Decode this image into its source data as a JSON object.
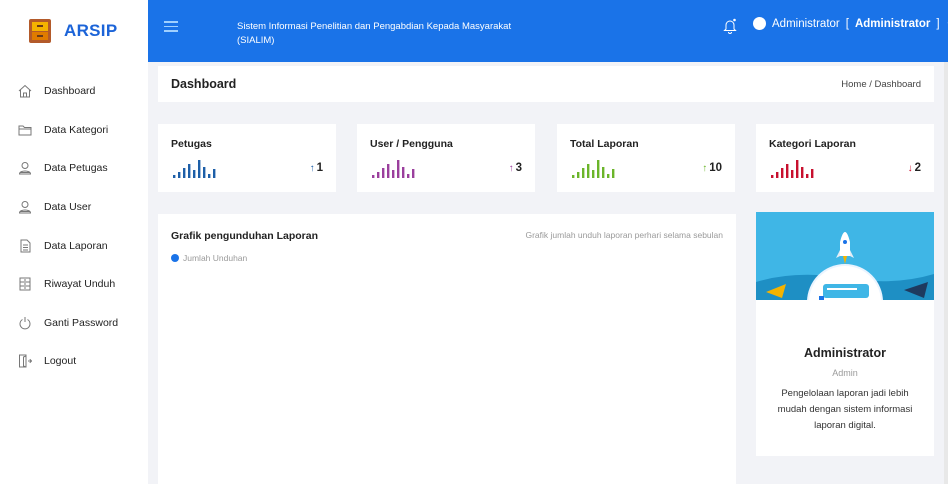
{
  "brand": {
    "name": "ARSIP"
  },
  "topbar": {
    "title": "Sistem Informasi Penelitian dan Pengabdian Kepada Masyarakat (SIALIM)",
    "user_name": "Administrator",
    "user_role_bracket": "[ ",
    "user_role": "Administrator",
    "user_role_close": " ]"
  },
  "sidebar": {
    "items": [
      {
        "label": "Dashboard",
        "icon": "home-icon"
      },
      {
        "label": "Data Kategori",
        "icon": "folder-icon"
      },
      {
        "label": "Data Petugas",
        "icon": "user-icon"
      },
      {
        "label": "Data User",
        "icon": "user-icon"
      },
      {
        "label": "Data Laporan",
        "icon": "document-icon"
      },
      {
        "label": "Riwayat Unduh",
        "icon": "archive-icon"
      },
      {
        "label": "Ganti Password",
        "icon": "power-icon"
      },
      {
        "label": "Logout",
        "icon": "logout-icon"
      }
    ]
  },
  "header": {
    "title": "Dashboard",
    "breadcrumb": "Home / Dashboard"
  },
  "stats": [
    {
      "label": "Petugas",
      "value": "1",
      "arrow": "↑",
      "color": "#1d5fa8",
      "arrow_color": "#1d5fa8"
    },
    {
      "label": "User / Pengguna",
      "value": "3",
      "arrow": "↑",
      "color": "#9b3f9d",
      "arrow_color": "#9b3f9d"
    },
    {
      "label": "Total Laporan",
      "value": "10",
      "arrow": "↑",
      "color": "#6bb52a",
      "arrow_color": "#6bb52a"
    },
    {
      "label": "Kategori Laporan",
      "value": "2",
      "arrow": "↓",
      "color": "#c8102e",
      "arrow_color": "#c8102e"
    }
  ],
  "chart": {
    "title": "Grafik pengunduhan Laporan",
    "subtitle": "Grafik jumlah unduh laporan perhari selama sebulan",
    "legend": "Jumlah Unduhan",
    "legend_color": "#1a73e8"
  },
  "profile": {
    "name": "Administrator",
    "role": "Admin",
    "description": "Pengelolaan laporan jadi lebih mudah dengan sistem informasi laporan digital."
  },
  "colors": {
    "topbar": "#1a73e8",
    "brand": "#1c64d8",
    "background": "#f2f3f7"
  }
}
